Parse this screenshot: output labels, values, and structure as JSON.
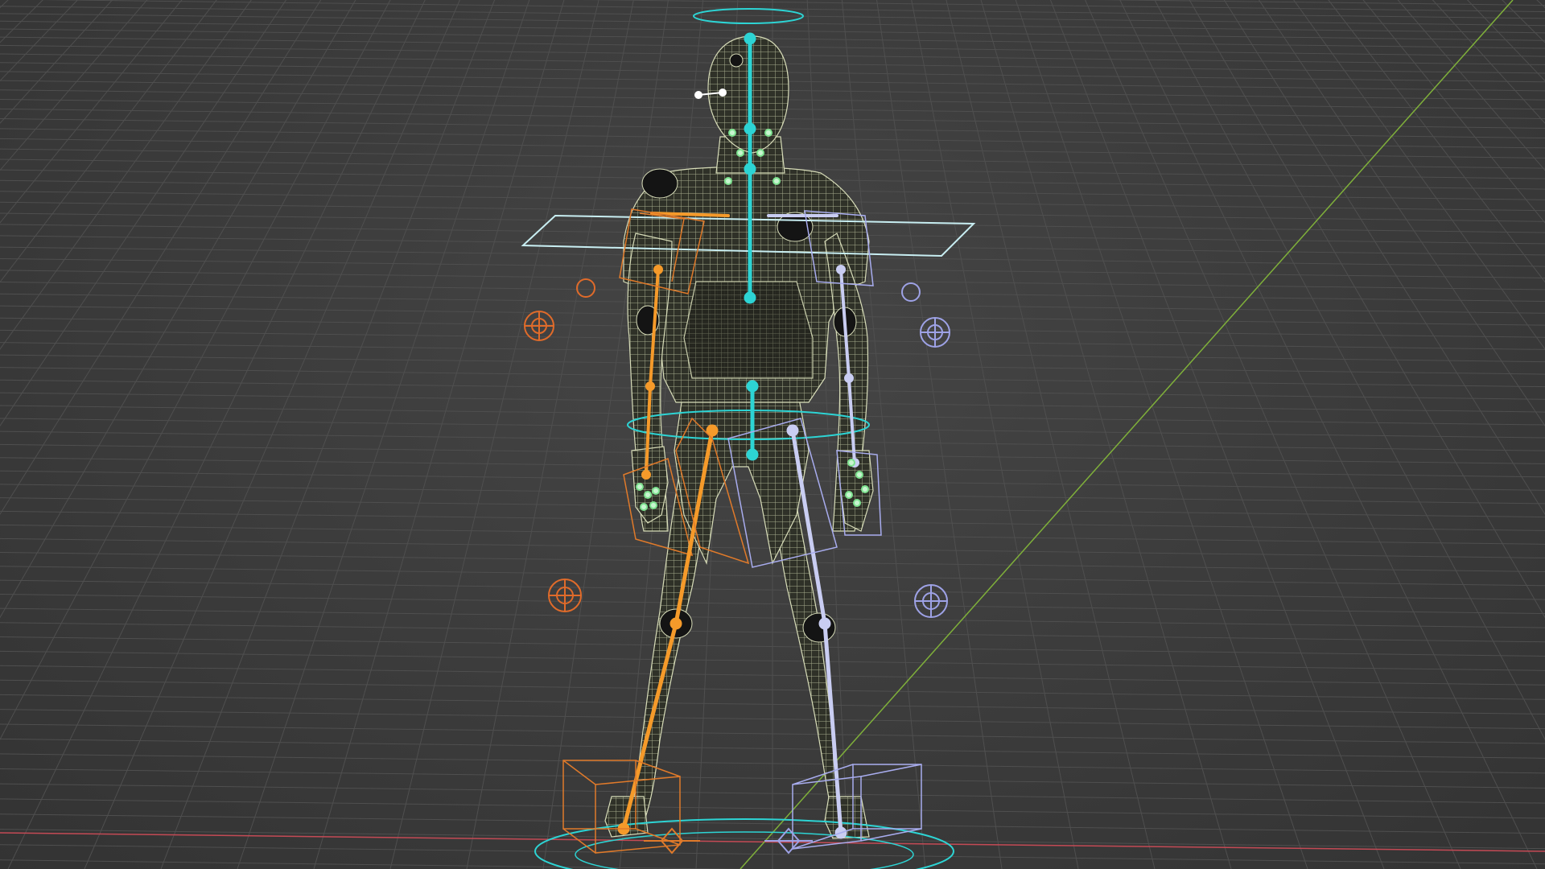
{
  "viewport": {
    "background": "#3d3d3d",
    "grid_line_color": "#4e4e4e",
    "x_axis_color": "#c44a55",
    "y_axis_color": "#7fb03a"
  },
  "rig": {
    "mesh_fill": "#2f3128",
    "mesh_wire": "#d5dbb6",
    "spine_color": "#2dd4d4",
    "left_side_color": "#f59a2a",
    "right_side_color": "#c9cdf2",
    "finger_bone_color": "#7de28f",
    "control_color_center": "#3ad3d3",
    "control_color_left": "#e06b2a",
    "control_color_right": "#9ea2e6"
  },
  "icons": [
    "pole-target-icon",
    "ik-foot-control-icon",
    "root-control-icon",
    "head-control-icon"
  ]
}
